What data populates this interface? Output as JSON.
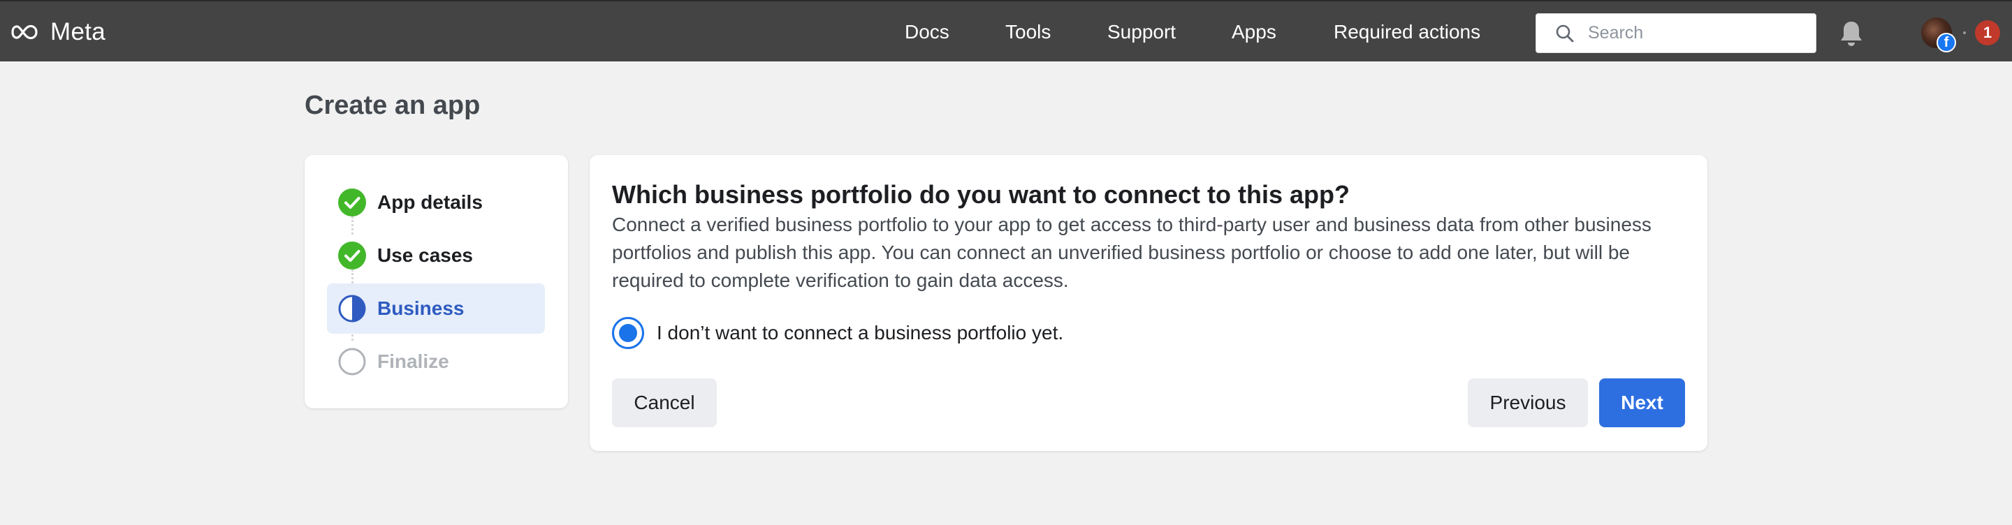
{
  "topbar": {
    "logo_text": "Meta",
    "nav": [
      {
        "label": "Docs"
      },
      {
        "label": "Tools"
      },
      {
        "label": "Support"
      },
      {
        "label": "Apps"
      },
      {
        "label": "Required actions"
      }
    ],
    "search_placeholder": "Search",
    "notification_count": "1",
    "fb_badge": "f"
  },
  "page": {
    "title": "Create an app"
  },
  "stepper": {
    "steps": [
      {
        "label": "App details",
        "state": "complete"
      },
      {
        "label": "Use cases",
        "state": "complete"
      },
      {
        "label": "Business",
        "state": "active"
      },
      {
        "label": "Finalize",
        "state": "pending"
      }
    ]
  },
  "main": {
    "question": "Which business portfolio do you want to connect to this app?",
    "description": "Connect a verified business portfolio to your app to get access to third-party user and business data from other business portfolios and publish this app. You can connect an unverified business portfolio or choose to add one later, but will be required to complete verification to gain data access.",
    "option_label": "I don’t want to connect a business portfolio yet.",
    "option_selected": true,
    "cancel_label": "Cancel",
    "previous_label": "Previous",
    "next_label": "Next"
  },
  "colors": {
    "topbar_bg": "#444444",
    "complete_green": "#42b72a",
    "active_blue": "#2f5bc0",
    "primary_button": "#2d6fe0",
    "notification_red": "#c0392b"
  }
}
